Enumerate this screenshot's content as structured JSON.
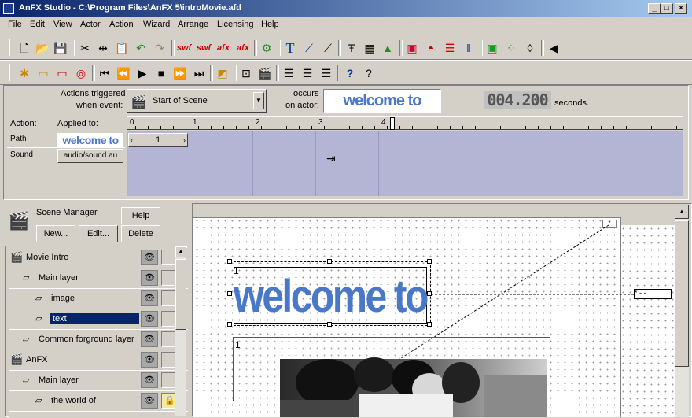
{
  "window": {
    "title": "AnFX Studio - C:\\Program Files\\AnFX 5\\introMovie.afd",
    "min": "_",
    "max": "□",
    "close": "×"
  },
  "menu": [
    "File",
    "Edit",
    "View",
    "Actor",
    "Action",
    "Wizard",
    "Arrange",
    "Licensing",
    "Help"
  ],
  "toolbar1": {
    "swf1": "swf",
    "swf2": "swf",
    "afx1": "afx",
    "afx2": "afx"
  },
  "event": {
    "actions_triggered": "Actions triggered",
    "when_event": "when event:",
    "event_value": "Start of Scene",
    "occurs": "occurs",
    "on_actor": "on actor:",
    "actor_value": "welcome to",
    "time_display": "004.200",
    "seconds": "seconds.",
    "action_label": "Action:",
    "applied_to": "Applied to:",
    "ruler": [
      "0",
      "1",
      "2",
      "3",
      "4"
    ],
    "rows": [
      {
        "name": "Path",
        "value": "welcome to"
      },
      {
        "name": "Sound",
        "value": "audio/sound.au"
      }
    ],
    "keyframe": "1"
  },
  "scene_manager": {
    "title": "Scene Manager",
    "help": "Help",
    "new": "New...",
    "edit": "Edit...",
    "delete": "Delete",
    "items": [
      {
        "label": "Movie Intro"
      },
      {
        "label": "Main layer"
      },
      {
        "label": "image"
      },
      {
        "label": "text"
      },
      {
        "label": "Common forground layer"
      },
      {
        "label": "AnFX"
      },
      {
        "label": "Main layer"
      },
      {
        "label": "the world of"
      }
    ]
  },
  "canvas": {
    "text_layer_number": "1",
    "text_content": "welcome to",
    "image_layer_number": "1",
    "text_color": "#4a78c8"
  }
}
